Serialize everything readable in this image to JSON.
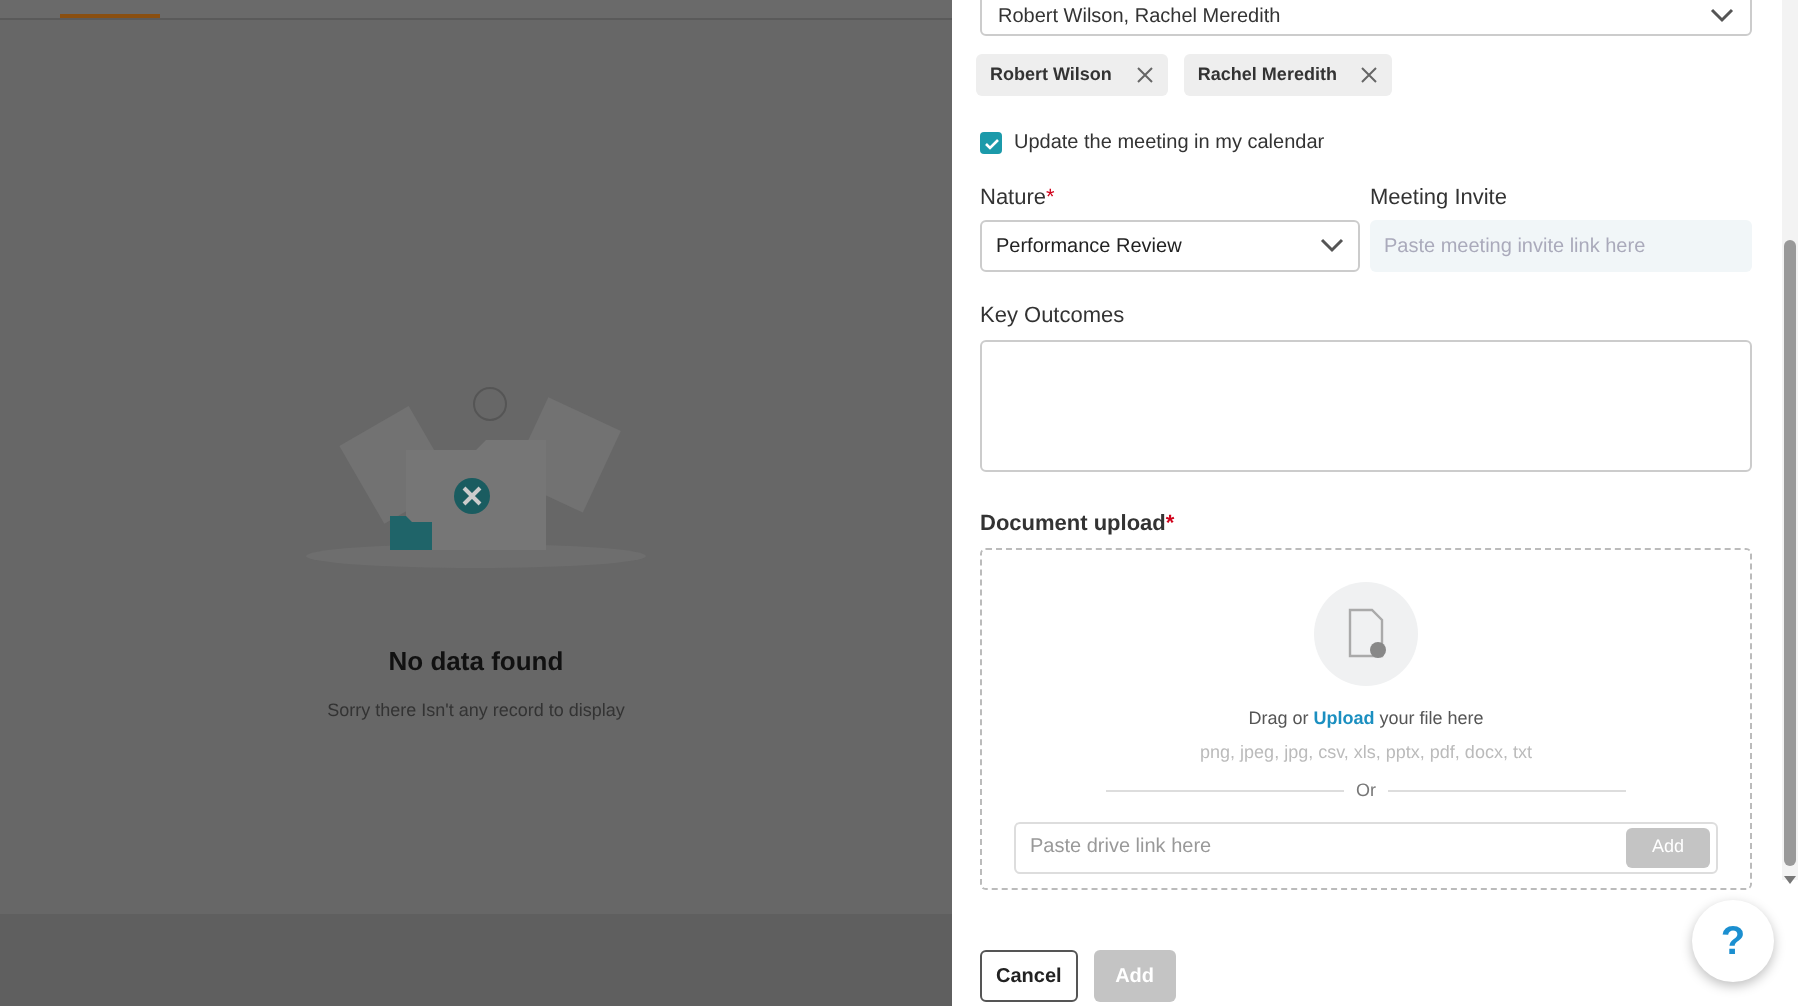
{
  "empty_state": {
    "title": "No data found",
    "message": "Sorry there Isn't any record to display"
  },
  "attendees_select": {
    "value": "Robert Wilson, Rachel Meredith"
  },
  "attendee_chips": [
    {
      "label": "Robert Wilson"
    },
    {
      "label": "Rachel Meredith"
    }
  ],
  "calendar_update": {
    "label": "Update the meeting in my calendar",
    "checked": true
  },
  "nature": {
    "label": "Nature",
    "required_mark": "*",
    "value": "Performance Review"
  },
  "meeting_invite": {
    "label": "Meeting Invite",
    "placeholder": "Paste meeting invite link here"
  },
  "key_outcomes": {
    "label": "Key Outcomes"
  },
  "document_upload": {
    "label": "Document upload",
    "required_mark": "*",
    "prompt_before": "Drag or",
    "link": "Upload",
    "prompt_after": "your file here",
    "formats": "png, jpeg, jpg, csv, xls, pptx, pdf, docx, txt",
    "divider": "Or",
    "drive_link": {
      "placeholder": "Paste drive link here",
      "button": "Add"
    }
  },
  "footer": {
    "cancel": "Cancel",
    "submit": {
      "label": "Add",
      "disabled": true
    }
  },
  "help": {
    "label": "?"
  }
}
